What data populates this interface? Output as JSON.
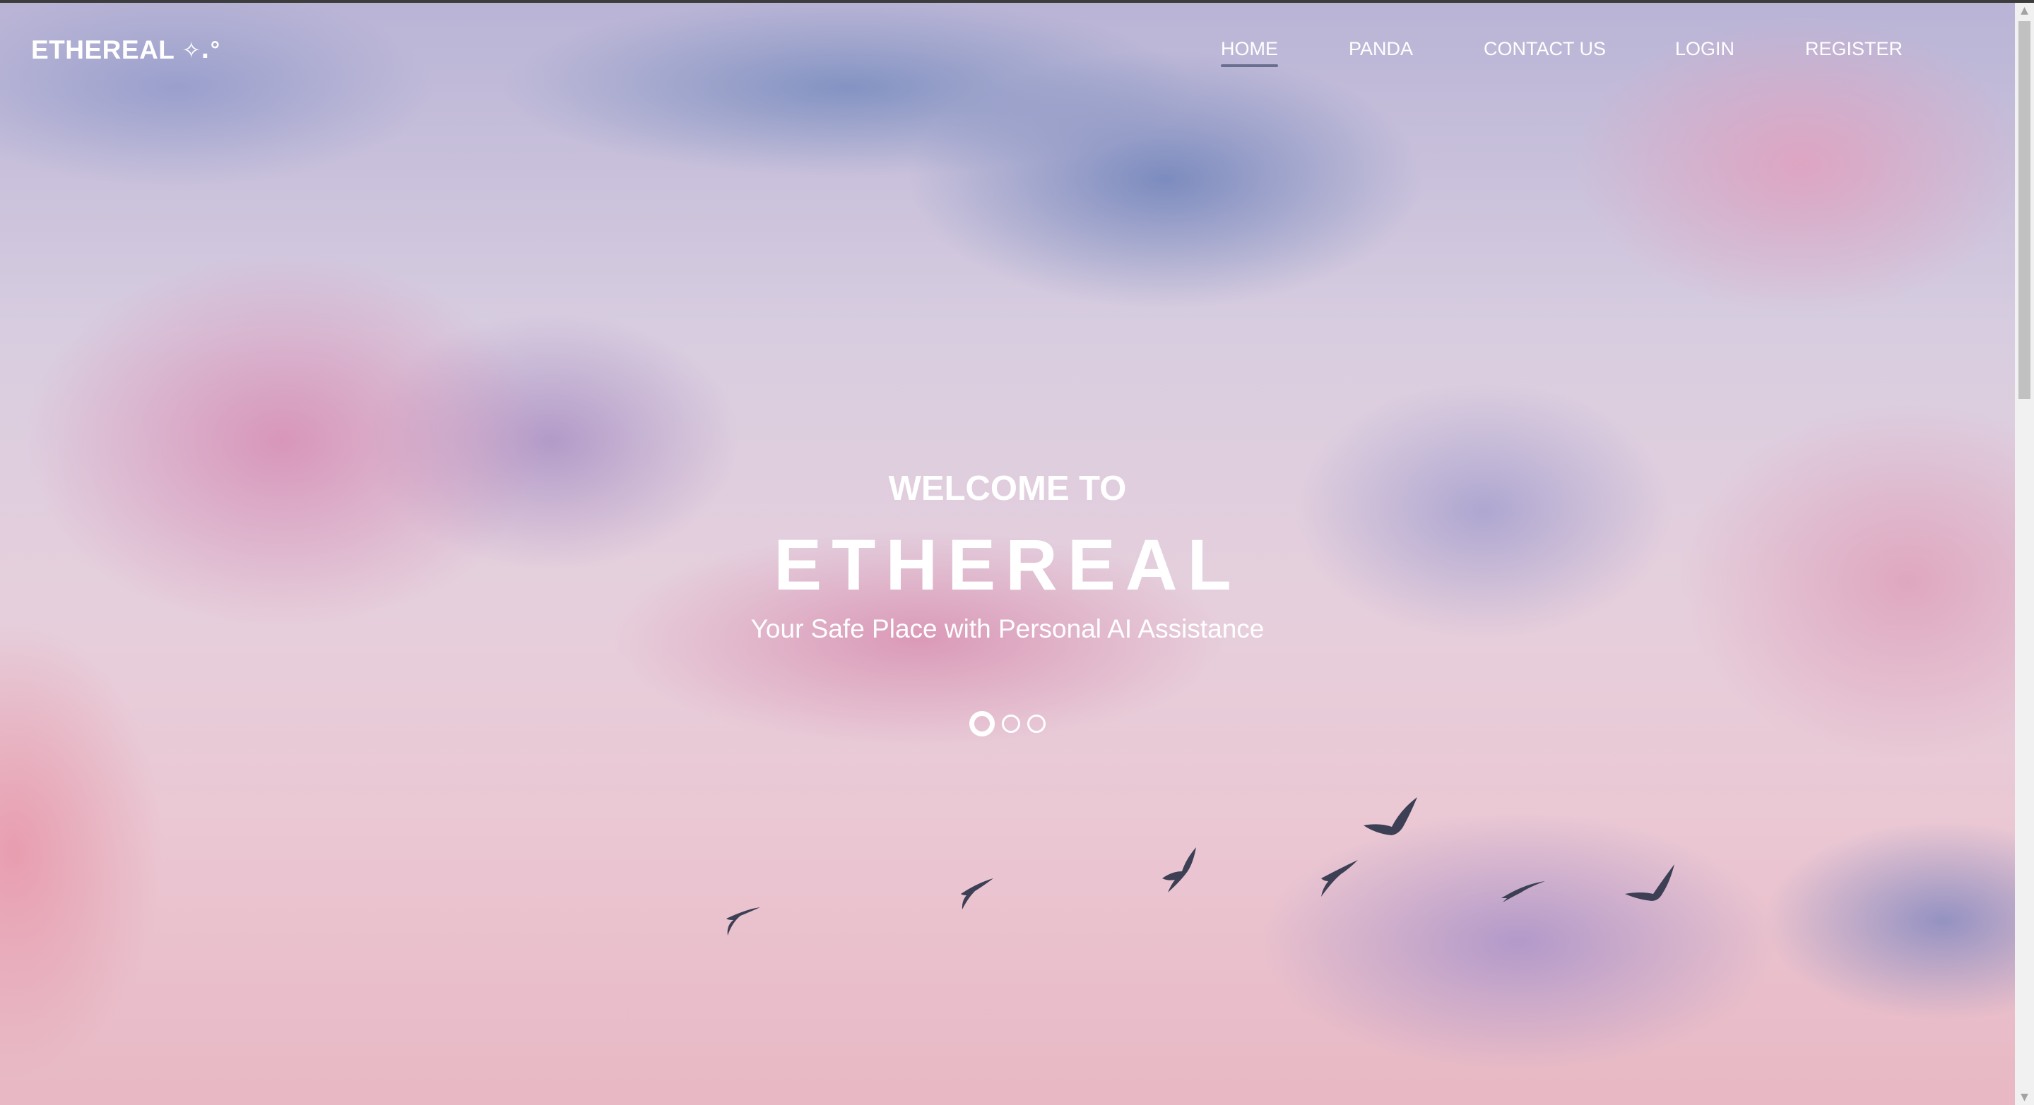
{
  "header": {
    "logo_text": "ETHEREAL",
    "logo_mark": "✧.°"
  },
  "nav": {
    "items": [
      {
        "label": "HOME",
        "active": true
      },
      {
        "label": "PANDA",
        "active": false
      },
      {
        "label": "CONTACT US",
        "active": false
      },
      {
        "label": "LOGIN",
        "active": false
      },
      {
        "label": "REGISTER",
        "active": false
      }
    ]
  },
  "hero": {
    "welcome": "WELCOME TO",
    "brand": "ETHEREAL",
    "tagline": "Your Safe Place with Personal AI Assistance",
    "slides_total": 3,
    "active_slide": 1
  },
  "colors": {
    "nav_underline": "#6a6f90",
    "text": "#ffffff"
  },
  "icons": {
    "scroll_up": "scroll-up-arrow",
    "scroll_down": "scroll-down-arrow"
  }
}
